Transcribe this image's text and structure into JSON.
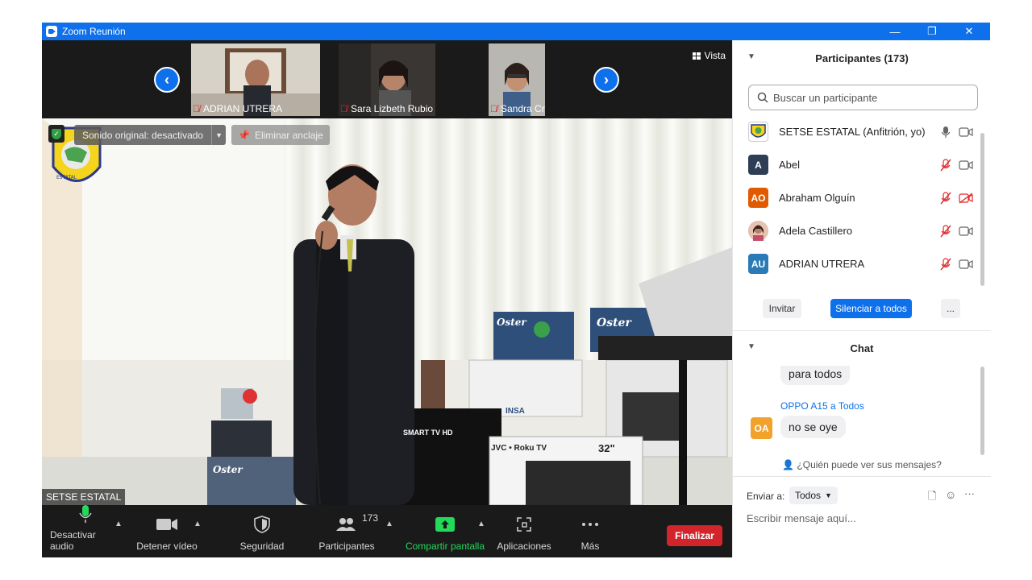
{
  "window": {
    "title": "Zoom Reunión",
    "controls": {
      "minimize": "—",
      "restore": "❐",
      "close": "✕"
    }
  },
  "strip": {
    "vista_label": "Vista",
    "thumbs": [
      {
        "name": "ADRIAN UTRERA"
      },
      {
        "name": "Sara Lizbeth Rubio Ji..."
      },
      {
        "name": "Sandra Cruz Reyes"
      }
    ]
  },
  "main_video": {
    "speaker_name": "SETSE ESTATAL",
    "original_sound": "Sonido original: desactivado",
    "unpin": "Eliminar anclaje",
    "brand_labels": {
      "tv1": "SMART TV HD",
      "tv2": "JVC • Roku TV",
      "size": "32\"",
      "oster1": "Oster",
      "oster2": "Oster",
      "oster3": "Oster",
      "insa": "INSA"
    }
  },
  "toolbar": {
    "mute": "Desactivar audio",
    "video": "Detener vídeo",
    "security": "Seguridad",
    "participants": "Participantes",
    "participants_count": "173",
    "share": "Compartir pantalla",
    "apps": "Aplicaciones",
    "more": "Más",
    "end": "Finalizar"
  },
  "participants": {
    "header": "Participantes (173)",
    "search_placeholder": "Buscar un participante",
    "list": [
      {
        "name": "SETSE ESTATAL (Anfitrión, yo)",
        "initials": "",
        "color": "#ffffff",
        "mic": "on",
        "cam": "on"
      },
      {
        "name": "Abel",
        "initials": "A",
        "color": "#2d3e55",
        "mic": "muted",
        "cam": "on"
      },
      {
        "name": "Abraham Olguín",
        "initials": "AO",
        "color": "#e05a00",
        "mic": "muted",
        "cam": "off"
      },
      {
        "name": "Adela Castillero",
        "initials": "",
        "color": "#d9a08a",
        "mic": "muted",
        "cam": "on"
      },
      {
        "name": "ADRIAN UTRERA",
        "initials": "AU",
        "color": "#2a7ab5",
        "mic": "muted",
        "cam": "on"
      }
    ],
    "invite": "Invitar",
    "mute_all": "Silenciar a todos",
    "more": "..."
  },
  "chat": {
    "header": "Chat",
    "messages": [
      {
        "sender": "",
        "text": "para todos"
      },
      {
        "sender": "OPPO A15 a Todos",
        "initials": "OA",
        "text": "no se oye"
      }
    ],
    "who_sees": "¿Quién puede ver sus mensajes?",
    "send_to_label": "Enviar a:",
    "send_to_value": "Todos",
    "input_placeholder": "Escribir mensaje aquí..."
  },
  "colors": {
    "accent": "#0e71eb",
    "end_red": "#d4242b",
    "share_green": "#23d959",
    "mute_red": "#e02828"
  }
}
